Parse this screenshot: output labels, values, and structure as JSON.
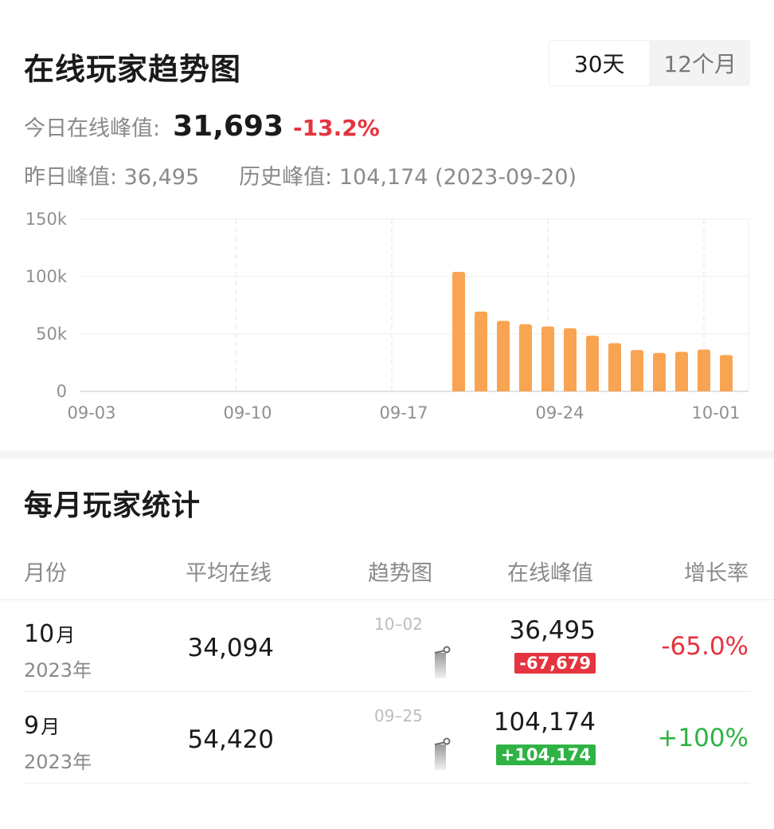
{
  "trend": {
    "title": "在线玩家趋势图",
    "range_options": [
      "30天",
      "12个月"
    ],
    "today_label": "今日在线峰值:",
    "today_value": "31,693",
    "today_change": "-13.2%",
    "yesterday_text": "昨日峰值: 36,495",
    "history_text": "历史峰值: 104,174 (2023-09-20)"
  },
  "colors": {
    "bar": "#f9a452",
    "negative": "#e5343f",
    "positive": "#2fb344"
  },
  "chart_data": {
    "type": "bar",
    "x_tick_labels": [
      "09-03",
      "09-10",
      "09-17",
      "09-24",
      "10-01"
    ],
    "y_tick_labels": [
      "0",
      "50k",
      "100k",
      "150k"
    ],
    "ylim": [
      0,
      150000
    ],
    "categories": [
      "09-20",
      "09-21",
      "09-22",
      "09-23",
      "09-24",
      "09-25",
      "09-26",
      "09-27",
      "09-28",
      "09-29",
      "09-30",
      "10-01",
      "10-02"
    ],
    "values": [
      104174,
      69500,
      61500,
      58500,
      56500,
      55000,
      48500,
      42000,
      36000,
      33500,
      34500,
      36495,
      31693
    ],
    "grid": true
  },
  "monthly": {
    "title": "每月玩家统计",
    "headers": {
      "month": "月份",
      "avg": "平均在线",
      "trend": "趋势图",
      "peak": "在线峰值",
      "growth": "增长率"
    },
    "rows": [
      {
        "month": "10",
        "month_unit": "月",
        "year": "2023年",
        "avg": "34,094",
        "spark_date": "10–02",
        "peak": "36,495",
        "delta": "-67,679",
        "delta_sign": "neg",
        "rate": "-65.0%",
        "rate_sign": "neg"
      },
      {
        "month": "9",
        "month_unit": "月",
        "year": "2023年",
        "avg": "54,420",
        "spark_date": "09–25",
        "peak": "104,174",
        "delta": "+104,174",
        "delta_sign": "pos",
        "rate": "+100%",
        "rate_sign": "pos"
      }
    ]
  }
}
